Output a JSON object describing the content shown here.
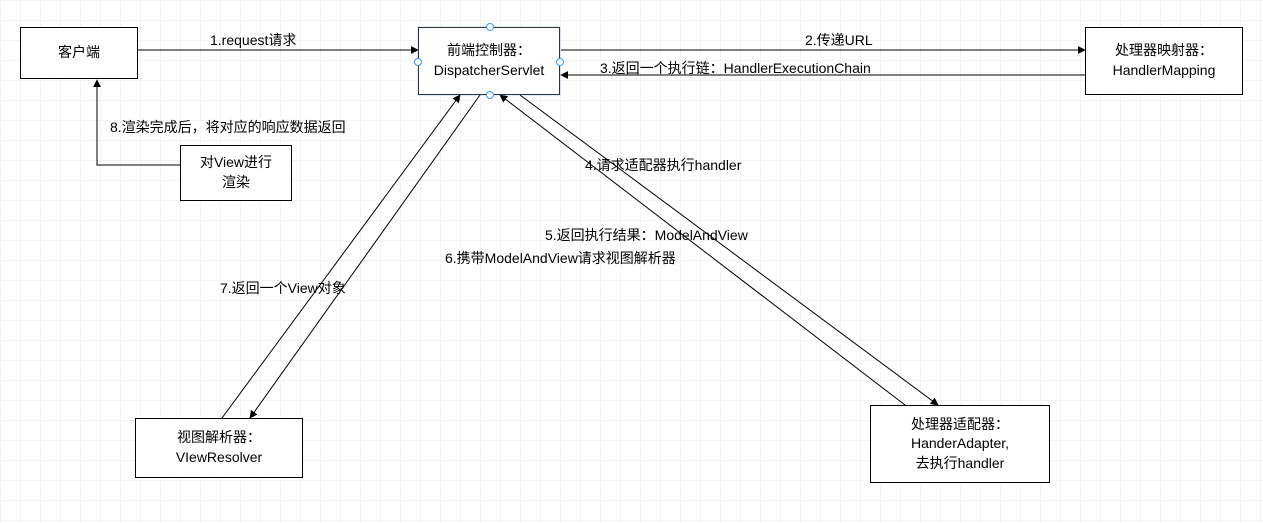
{
  "nodes": {
    "client": {
      "line1": "客户端"
    },
    "dispatcher": {
      "line1": "前端控制器：",
      "line2": "DispatcherServlet"
    },
    "mapping": {
      "line1": "处理器映射器：",
      "line2": "HandlerMapping"
    },
    "render": {
      "line1": "对View进行",
      "line2": "渲染"
    },
    "adapter": {
      "line1": "处理器适配器：",
      "line2": "HanderAdapter,",
      "line3": "去执行handler"
    },
    "resolver": {
      "line1": "视图解析器：",
      "line2": "VIewResolver"
    }
  },
  "edges": {
    "e1": "1.request请求",
    "e2": "2.传递URL",
    "e3": "3.返回一个执行链：HandlerExecutionChain",
    "e4": "4.请求适配器执行handler",
    "e5": "5.返回执行结果：ModelAndView",
    "e6": "6.携带ModelAndView请求视图解析器",
    "e7": "7.返回一个View对象",
    "e8": "8.渲染完成后，将对应的响应数据返回"
  }
}
